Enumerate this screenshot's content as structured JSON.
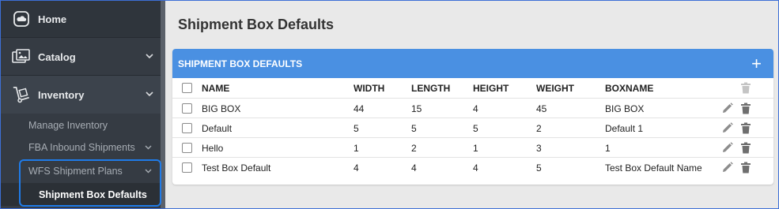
{
  "sidebar": {
    "home": {
      "label": "Home",
      "icon": "cloud-icon"
    },
    "catalog": {
      "label": "Catalog",
      "icon": "images-icon"
    },
    "inventory": {
      "label": "Inventory",
      "icon": "dolly-icon"
    },
    "sub_items": [
      {
        "label": "Manage Inventory"
      },
      {
        "label": "FBA Inbound Shipments"
      },
      {
        "label": "WFS Shipment Plans"
      },
      {
        "label": "Shipment Box Defaults"
      }
    ]
  },
  "page": {
    "title": "Shipment Box Defaults"
  },
  "panel": {
    "title": "SHIPMENT BOX DEFAULTS",
    "add_label": "+",
    "columns": [
      "NAME",
      "WIDTH",
      "LENGTH",
      "HEIGHT",
      "WEIGHT",
      "BOXNAME"
    ],
    "rows": [
      {
        "name": "BIG BOX",
        "width": "44",
        "length": "15",
        "height": "4",
        "weight": "45",
        "boxname": "BIG BOX"
      },
      {
        "name": "Default",
        "width": "5",
        "length": "5",
        "height": "5",
        "weight": "2",
        "boxname": "Default 1"
      },
      {
        "name": "Hello",
        "width": "1",
        "length": "2",
        "height": "1",
        "weight": "3",
        "boxname": "1"
      },
      {
        "name": "Test Box Default",
        "width": "4",
        "length": "4",
        "height": "4",
        "weight": "5",
        "boxname": "Test Box Default Name"
      }
    ]
  },
  "colors": {
    "sidebar_bg": "#353b43",
    "panel_header": "#4a90e2",
    "highlight": "#1f7be8"
  }
}
